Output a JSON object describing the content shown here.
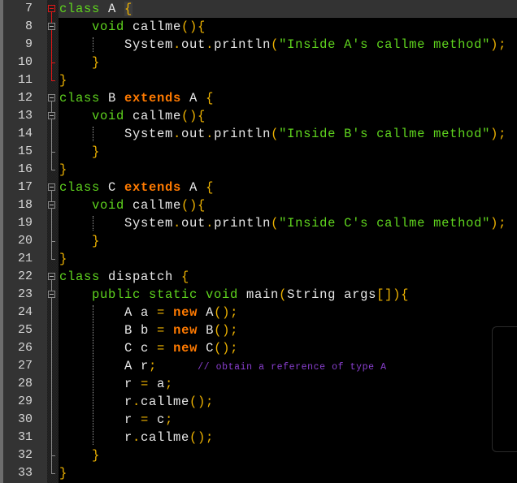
{
  "editor": {
    "language": "java",
    "current_line": 7,
    "colors": {
      "background": "#000000",
      "gutter": "#333333",
      "keyword_green": "#5fd41e",
      "keyword_orange": "#ff7a00",
      "punctuation": "#f0b400",
      "string": "#5fd41e",
      "comment": "#8a3fd0",
      "fold_active": "#e01818"
    },
    "lines": [
      {
        "n": "7",
        "tokens": [
          [
            "kw-green",
            "class"
          ],
          [
            "plain",
            " A "
          ],
          [
            "punc brace-match",
            "{"
          ]
        ]
      },
      {
        "n": "8",
        "tokens": [
          [
            "plain",
            "    "
          ],
          [
            "kw-green",
            "void"
          ],
          [
            "plain",
            " callme"
          ],
          [
            "punc",
            "(){"
          ]
        ]
      },
      {
        "n": "9",
        "tokens": [
          [
            "plain",
            "        System"
          ],
          [
            "punc",
            "."
          ],
          [
            "plain",
            "out"
          ],
          [
            "punc",
            "."
          ],
          [
            "plain",
            "println"
          ],
          [
            "punc",
            "("
          ],
          [
            "str",
            "\"Inside A's callme method\""
          ],
          [
            "punc",
            ");"
          ]
        ]
      },
      {
        "n": "10",
        "tokens": [
          [
            "plain",
            "    "
          ],
          [
            "punc",
            "}"
          ]
        ]
      },
      {
        "n": "11",
        "tokens": [
          [
            "punc",
            "}"
          ]
        ]
      },
      {
        "n": "12",
        "tokens": [
          [
            "kw-green",
            "class"
          ],
          [
            "plain",
            " B "
          ],
          [
            "kw-orange",
            "extends"
          ],
          [
            "plain",
            " A "
          ],
          [
            "punc",
            "{"
          ]
        ]
      },
      {
        "n": "13",
        "tokens": [
          [
            "plain",
            "    "
          ],
          [
            "kw-green",
            "void"
          ],
          [
            "plain",
            " callme"
          ],
          [
            "punc",
            "(){"
          ]
        ]
      },
      {
        "n": "14",
        "tokens": [
          [
            "plain",
            "        System"
          ],
          [
            "punc",
            "."
          ],
          [
            "plain",
            "out"
          ],
          [
            "punc",
            "."
          ],
          [
            "plain",
            "println"
          ],
          [
            "punc",
            "("
          ],
          [
            "str",
            "\"Inside B's callme method\""
          ],
          [
            "punc",
            ");"
          ]
        ]
      },
      {
        "n": "15",
        "tokens": [
          [
            "plain",
            "    "
          ],
          [
            "punc",
            "}"
          ]
        ]
      },
      {
        "n": "16",
        "tokens": [
          [
            "punc",
            "}"
          ]
        ]
      },
      {
        "n": "17",
        "tokens": [
          [
            "kw-green",
            "class"
          ],
          [
            "plain",
            " C "
          ],
          [
            "kw-orange",
            "extends"
          ],
          [
            "plain",
            " A "
          ],
          [
            "punc",
            "{"
          ]
        ]
      },
      {
        "n": "18",
        "tokens": [
          [
            "plain",
            "    "
          ],
          [
            "kw-green",
            "void"
          ],
          [
            "plain",
            " callme"
          ],
          [
            "punc",
            "(){"
          ]
        ]
      },
      {
        "n": "19",
        "tokens": [
          [
            "plain",
            "        System"
          ],
          [
            "punc",
            "."
          ],
          [
            "plain",
            "out"
          ],
          [
            "punc",
            "."
          ],
          [
            "plain",
            "println"
          ],
          [
            "punc",
            "("
          ],
          [
            "str",
            "\"Inside C's callme method\""
          ],
          [
            "punc",
            ");"
          ]
        ]
      },
      {
        "n": "20",
        "tokens": [
          [
            "plain",
            "    "
          ],
          [
            "punc",
            "}"
          ]
        ]
      },
      {
        "n": "21",
        "tokens": [
          [
            "punc",
            "}"
          ]
        ]
      },
      {
        "n": "22",
        "tokens": [
          [
            "kw-green",
            "class"
          ],
          [
            "plain",
            " dispatch "
          ],
          [
            "punc",
            "{"
          ]
        ]
      },
      {
        "n": "23",
        "tokens": [
          [
            "plain",
            "    "
          ],
          [
            "kw-green",
            "public static void"
          ],
          [
            "plain",
            " main"
          ],
          [
            "punc",
            "("
          ],
          [
            "plain",
            "String args"
          ],
          [
            "punc",
            "[]){"
          ]
        ]
      },
      {
        "n": "24",
        "tokens": [
          [
            "plain",
            "        A a "
          ],
          [
            "punc",
            "="
          ],
          [
            "plain",
            " "
          ],
          [
            "kw-orange",
            "new"
          ],
          [
            "plain",
            " A"
          ],
          [
            "punc",
            "();"
          ]
        ]
      },
      {
        "n": "25",
        "tokens": [
          [
            "plain",
            "        B b "
          ],
          [
            "punc",
            "="
          ],
          [
            "plain",
            " "
          ],
          [
            "kw-orange",
            "new"
          ],
          [
            "plain",
            " B"
          ],
          [
            "punc",
            "();"
          ]
        ]
      },
      {
        "n": "26",
        "tokens": [
          [
            "plain",
            "        C c "
          ],
          [
            "punc",
            "="
          ],
          [
            "plain",
            " "
          ],
          [
            "kw-orange",
            "new"
          ],
          [
            "plain",
            " C"
          ],
          [
            "punc",
            "();"
          ]
        ]
      },
      {
        "n": "27",
        "tokens": [
          [
            "plain",
            "        A r"
          ],
          [
            "punc",
            ";"
          ],
          [
            "plain",
            "     "
          ],
          [
            "cmt",
            "// obtain a reference of type A"
          ]
        ]
      },
      {
        "n": "28",
        "tokens": [
          [
            "plain",
            "        r "
          ],
          [
            "punc",
            "="
          ],
          [
            "plain",
            " a"
          ],
          [
            "punc",
            ";"
          ]
        ]
      },
      {
        "n": "29",
        "tokens": [
          [
            "plain",
            "        r"
          ],
          [
            "punc",
            "."
          ],
          [
            "plain",
            "callme"
          ],
          [
            "punc",
            "();"
          ]
        ]
      },
      {
        "n": "30",
        "tokens": [
          [
            "plain",
            "        r "
          ],
          [
            "punc",
            "="
          ],
          [
            "plain",
            " c"
          ],
          [
            "punc",
            ";"
          ]
        ]
      },
      {
        "n": "31",
        "tokens": [
          [
            "plain",
            "        r"
          ],
          [
            "punc",
            "."
          ],
          [
            "plain",
            "callme"
          ],
          [
            "punc",
            "();"
          ]
        ]
      },
      {
        "n": "32",
        "tokens": [
          [
            "plain",
            "    "
          ],
          [
            "punc",
            "}"
          ]
        ]
      },
      {
        "n": "33",
        "tokens": [
          [
            "punc",
            "}"
          ]
        ]
      }
    ]
  }
}
